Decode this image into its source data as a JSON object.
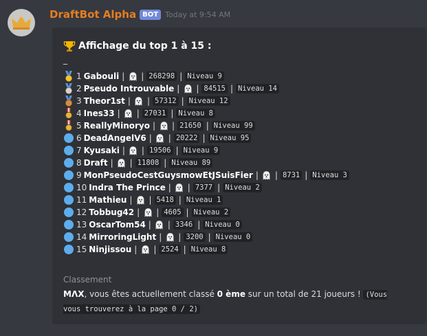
{
  "message": {
    "username": "DraftBot Alpha",
    "badge": "BOT",
    "timestamp": "Today at 9:54 AM",
    "avatar_icon": "crown-icon"
  },
  "embed": {
    "title": "Affichage du top 1 à 15 :",
    "title_icon": "trophy-icon",
    "dash": "_",
    "rows": [
      {
        "rank": "1",
        "name": "Gabouli",
        "points": "268298",
        "level": "Niveau 9",
        "icon": "gold-medal-icon"
      },
      {
        "rank": "2",
        "name": "Pseudo Introuvable",
        "points": "84515",
        "level": "Niveau 14",
        "icon": "silver-medal-icon"
      },
      {
        "rank": "3",
        "name": "Theor1st",
        "points": "57312",
        "level": "Niveau 12",
        "icon": "bronze-medal-icon"
      },
      {
        "rank": "4",
        "name": "Ines33",
        "points": "27031",
        "level": "Niveau 8",
        "icon": "military-medal-icon"
      },
      {
        "rank": "5",
        "name": "ReallyMinoryo",
        "points": "21650",
        "level": "Niveau 99",
        "icon": "military-medal-icon"
      },
      {
        "rank": "6",
        "name": "DeadAngelV6",
        "points": "20222",
        "level": "Niveau 95",
        "icon": "blue-circle-icon"
      },
      {
        "rank": "7",
        "name": "Kyusaki",
        "points": "19506",
        "level": "Niveau 9",
        "icon": "blue-circle-icon"
      },
      {
        "rank": "8",
        "name": "Draft",
        "points": "11808",
        "level": "Niveau 89",
        "icon": "blue-circle-icon"
      },
      {
        "rank": "9",
        "name": "MonPseudoCestGuysmowEtJSuisFier",
        "points": "8731",
        "level": "Niveau 3",
        "icon": "blue-circle-icon"
      },
      {
        "rank": "10",
        "name": "Indra The Prince",
        "points": "7377",
        "level": "Niveau 2",
        "icon": "blue-circle-icon"
      },
      {
        "rank": "11",
        "name": "Mathieu",
        "points": "5418",
        "level": "Niveau 1",
        "icon": "blue-circle-icon"
      },
      {
        "rank": "12",
        "name": "Tobbug42",
        "points": "4605",
        "level": "Niveau 2",
        "icon": "blue-circle-icon"
      },
      {
        "rank": "13",
        "name": "OscarTom54",
        "points": "3346",
        "level": "Niveau 0",
        "icon": "blue-circle-icon"
      },
      {
        "rank": "14",
        "name": "MirroringLight",
        "points": "3200",
        "level": "Niveau 0",
        "icon": "blue-circle-icon"
      },
      {
        "rank": "15",
        "name": "Ninjissou",
        "points": "2524",
        "level": "Niveau 8",
        "icon": "blue-circle-icon"
      }
    ],
    "classement_label": "Classement",
    "classement_user": "MΛX",
    "classement_text1": ", vous êtes actuellement classé ",
    "classement_rank": "0 ème",
    "classement_text2": " sur un total de 21 joueurs ! ",
    "classement_code": "(Vous vous trouverez à la page 0 / 2)"
  },
  "colors": {
    "background": "#36393f",
    "embed_bg": "#2f3136",
    "username": "#e67e22",
    "badge": "#7289da",
    "dot": "#5dadec"
  }
}
